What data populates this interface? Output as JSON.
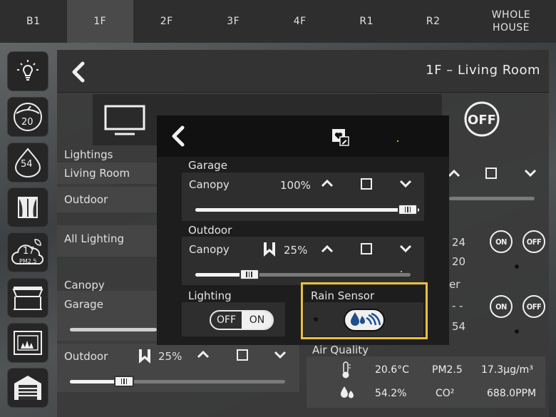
{
  "floors": [
    {
      "label": "B1",
      "active": false
    },
    {
      "label": "1F",
      "active": true
    },
    {
      "label": "2F",
      "active": false
    },
    {
      "label": "3F",
      "active": false
    },
    {
      "label": "4F",
      "active": false
    },
    {
      "label": "R1",
      "active": false
    },
    {
      "label": "R2",
      "active": false
    }
  ],
  "whole_house": "WHOLE HOUSE",
  "sidebar": {
    "temp_value": "20",
    "humidity_value": "54",
    "pm_value": "17",
    "pm_unit": "PM2.5"
  },
  "room": {
    "title": "1F – Living Room",
    "lightings_label": "Lightings",
    "living_room": "Living Room",
    "outdoor": "Outdoor",
    "all_lighting": "All Lighting",
    "canopy_label": "Canopy",
    "garage": "Garage",
    "outdoor_canopy": "Outdoor",
    "outdoor_percent": "25%",
    "air_quality": "Air Quality",
    "aq_temperature": "20.6°C",
    "aq_pm_label": "PM2.5",
    "aq_pm_value": "17.3μg/m³",
    "aq_humidity": "54.2%",
    "aq_co2_label": "CO²",
    "aq_co2_value": "688.0PPM",
    "climate_24": "24",
    "climate_20": "20",
    "climate_54": "54",
    "climate_dash": "- -",
    "partial_er": "er",
    "off_label": "OFF",
    "on_label": "ON"
  },
  "modal": {
    "garage_label": "Garage",
    "garage_canopy": "Canopy",
    "garage_percent": "100%",
    "garage_level": 1.0,
    "outdoor_label": "Outdoor",
    "outdoor_canopy": "Canopy",
    "outdoor_percent": "25%",
    "outdoor_level": 0.25,
    "lighting_label": "Lighting",
    "toggle_off": "OFF",
    "toggle_on": "ON",
    "rain_sensor_label": "Rain Sensor"
  },
  "colors": {
    "highlight_border": "#e8c040",
    "panel": "#3a3a3a",
    "modal": "#1d1d1d"
  }
}
